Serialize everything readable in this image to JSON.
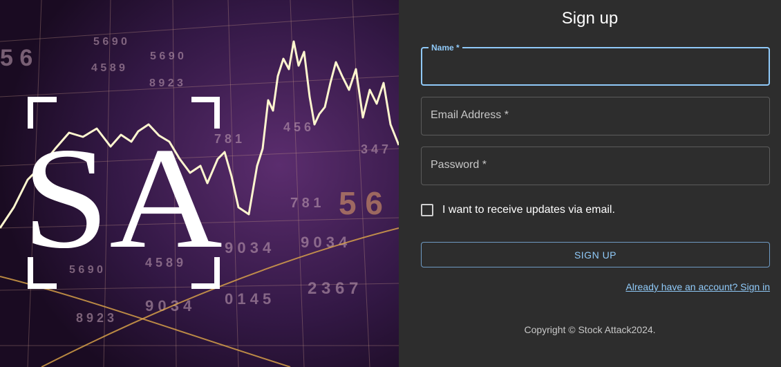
{
  "hero": {
    "logo_text": "SA",
    "background_digits": [
      "5 6",
      "5 6 9 0",
      "4 5 8 9",
      "5 6 9 0",
      "8 9 2 3",
      "7 8 1",
      "4 5 6",
      "9 0 3 4",
      "9 0 3 4",
      "5 6 9 0",
      "4 5 8 9",
      "9 0 3 4",
      "0 1 4 5",
      "2 3 6 7",
      "8 9 2 3",
      "7 8 1",
      "5 6",
      "3 4 7"
    ]
  },
  "form": {
    "title": "Sign up",
    "name_label": "Name *",
    "name_value": "",
    "email_label": "Email Address *",
    "password_label": "Password *",
    "checkbox_label": "I want to receive updates via email.",
    "checkbox_checked": false,
    "submit_label": "SIGN UP",
    "signin_link": "Already have an account? Sign in"
  },
  "footer": {
    "copyright": "Copyright © Stock Attack2024."
  },
  "colors": {
    "accent": "#90caf9",
    "panel_bg": "#2d2d2d",
    "hero_bg": "#2b1436"
  }
}
